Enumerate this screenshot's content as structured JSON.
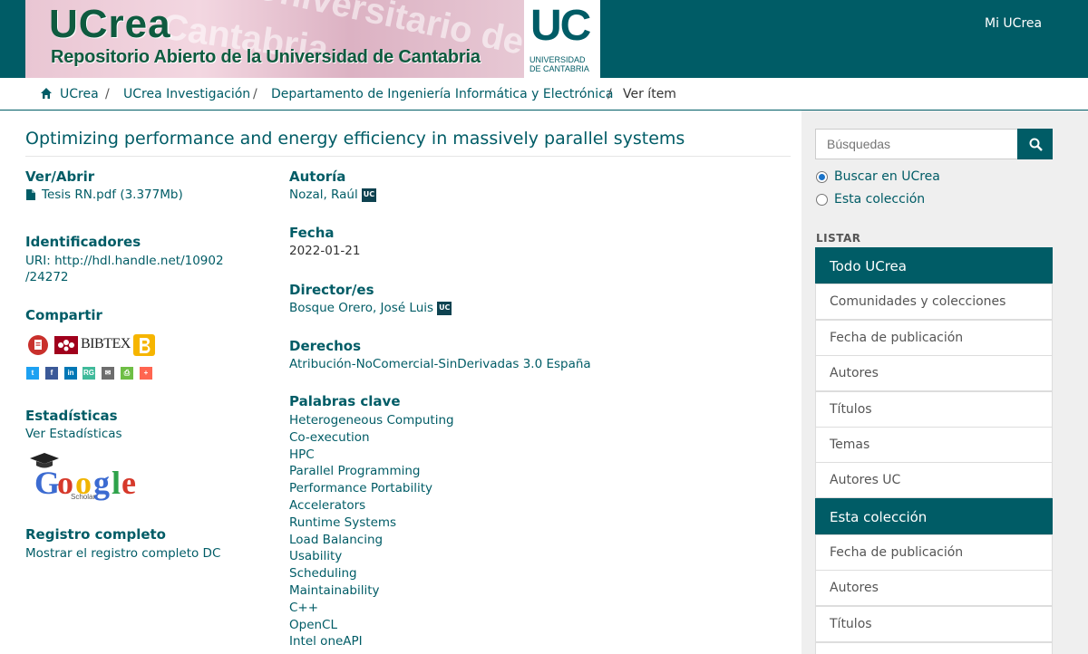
{
  "header": {
    "logo_title": "UCrea",
    "logo_subtitle": "Repositorio Abierto de la Universidad de Cantabria",
    "banner_bg_1": "Universitario de",
    "banner_bg_2": "Cantabria",
    "uc_logo": {
      "big": "UC",
      "line1": "UNIVERSIDAD",
      "line2": "DE CANTABRIA"
    },
    "user_link": "Mi UCrea"
  },
  "breadcrumb": {
    "items": [
      "UCrea",
      "UCrea Investigación",
      "Departamento de Ingeniería Informática y Electrónica"
    ],
    "current": "Ver ítem",
    "separator": "/"
  },
  "item": {
    "title": "Optimizing performance and energy efficiency in massively parallel systems",
    "ver_abrir": {
      "heading": "Ver/Abrir",
      "file": "Tesis RN.pdf (3.377Mb)"
    },
    "identificadores": {
      "heading": "Identificadores",
      "uri_line1": "URI: http://hdl.handle.net/10902",
      "uri_line2": "/24272"
    },
    "compartir": {
      "heading": "Compartir",
      "bibtex": "BIBTEX"
    },
    "estadisticas": {
      "heading": "Estadísticas",
      "link": "Ver Estadísticas"
    },
    "scholar": {
      "letters": [
        "G",
        "o",
        "o",
        "g",
        "l",
        "e"
      ],
      "sub": "Scholar"
    },
    "registro": {
      "heading": "Registro completo",
      "link": "Mostrar el registro completo DC"
    },
    "autoria": {
      "heading": "Autoría",
      "value": "Nozal, Raúl",
      "badge": "UC"
    },
    "fecha": {
      "heading": "Fecha",
      "value": "2022-01-21"
    },
    "director": {
      "heading": "Director/es",
      "value": "Bosque Orero, José Luis",
      "badge": "UC"
    },
    "derechos": {
      "heading": "Derechos",
      "value": "Atribución-NoComercial-SinDerivadas 3.0 España"
    },
    "palabras": {
      "heading": "Palabras clave",
      "items": [
        "Heterogeneous Computing",
        "Co-execution",
        "HPC",
        "Parallel Programming",
        "Performance Portability",
        "Accelerators",
        "Runtime Systems",
        "Load Balancing",
        "Usability",
        "Scheduling",
        "Maintainability",
        "C++",
        "OpenCL",
        "Intel oneAPI"
      ]
    }
  },
  "sidebar": {
    "search_placeholder": "Búsquedas",
    "radio_1": "Buscar en UCrea",
    "radio_2": "Esta colección",
    "listar_heading": "LISTAR",
    "todo_header": "Todo UCrea",
    "todo_items": [
      "Comunidades y colecciones",
      "Fecha de publicación",
      "Autores",
      "Títulos",
      "Temas",
      "Autores UC"
    ],
    "coleccion_header": "Esta colección",
    "coleccion_items": [
      "Fecha de publicación",
      "Autores",
      "Títulos"
    ]
  },
  "colors": {
    "primary": "#005c66",
    "badge": "#0e4250",
    "radio": "#1a73c9"
  }
}
